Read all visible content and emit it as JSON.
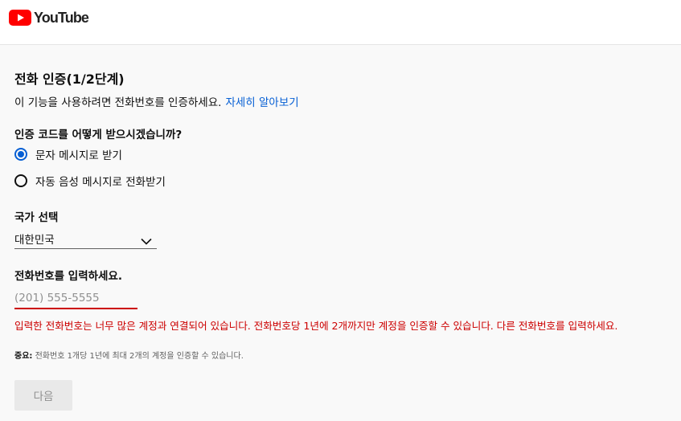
{
  "header": {
    "logo_text": "YouTube",
    "brand_color": "#ff0000"
  },
  "verification": {
    "title": "전화 인증(1/2단계)",
    "description": "이 기능을 사용하려면 전화번호를 인증하세요.",
    "learn_more_link": "자세히 알아보기",
    "question": "인증 코드를 어떻게 받으시겠습니까?",
    "options": [
      {
        "label": "문자 메시지로 받기",
        "selected": true
      },
      {
        "label": "자동 음성 메시지로 전화받기",
        "selected": false
      }
    ],
    "country_label": "국가 선택",
    "country_value": "대한민국",
    "phone_label": "전화번호를 입력하세요.",
    "phone_value": "",
    "phone_placeholder": "(201) 555-5555",
    "error_message": "입력한 전화번호는 너무 많은 계정과 연결되어 있습니다. 전화번호당 1년에 2개까지만 계정을 인증할 수 있습니다. 다른 전화번호를 입력하세요.",
    "note_prefix": "중요:",
    "note_text": "전화번호 1개당 1년에 최대 2개의 계정을 인증할 수 있습니다.",
    "next_button": "다음"
  },
  "colors": {
    "accent": "#065fd4",
    "error": "#cc0000",
    "disabled_button_bg": "#e9e9e9"
  }
}
